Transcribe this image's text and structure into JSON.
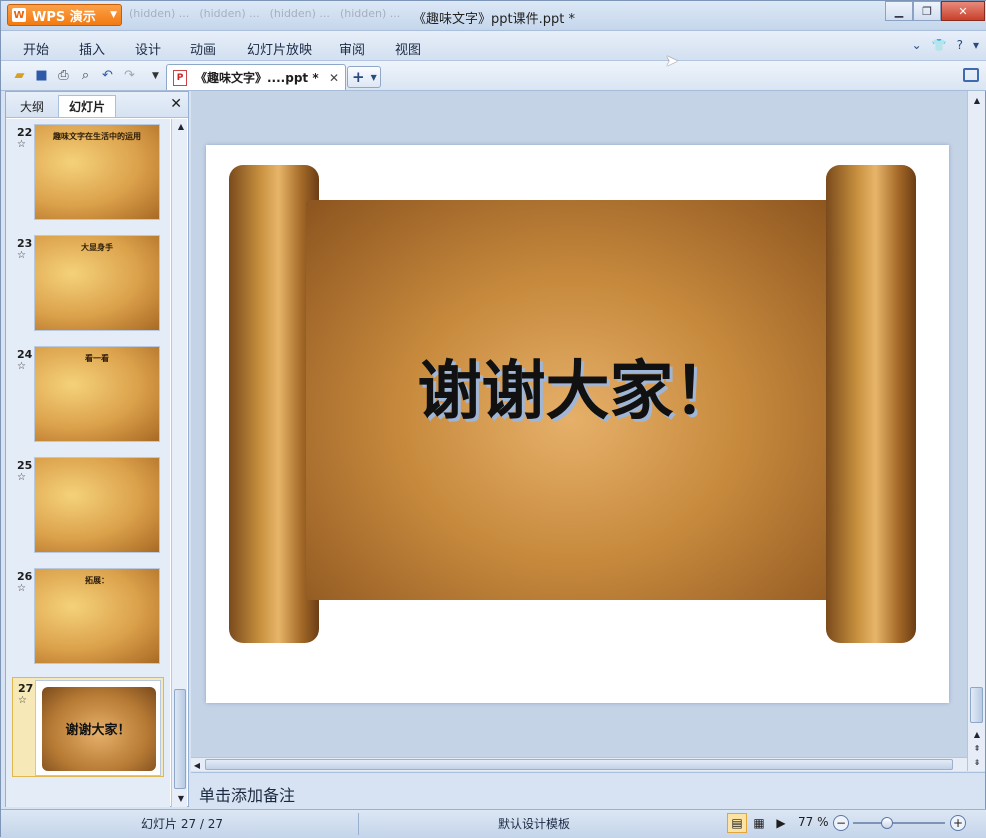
{
  "app": {
    "button_label": "WPS 演示",
    "window_title": "《趣味文字》ppt课件.ppt *",
    "ghost_tabs": [
      "(hidden) ...",
      "(hidden) ...",
      "(hidden) ...",
      "(hidden) ..."
    ]
  },
  "menu": [
    "开始",
    "插入",
    "设计",
    "动画",
    "幻灯片放映",
    "审阅",
    "视图"
  ],
  "toolbar": {
    "doc_tab_label": "《趣味文字》....ppt *",
    "new_tab_label": "+"
  },
  "left_pane": {
    "tab_outline": "大纲",
    "tab_slides": "幻灯片",
    "close_label": "✕",
    "thumbnails": [
      {
        "num": "22",
        "title": "趣味文字在生活中的运用"
      },
      {
        "num": "23",
        "title": "大显身手"
      },
      {
        "num": "24",
        "title": "看一看"
      },
      {
        "num": "25",
        "title": ""
      },
      {
        "num": "26",
        "title": "拓展："
      },
      {
        "num": "27",
        "title": "谢谢大家！"
      }
    ],
    "selected_index": 5
  },
  "slide": {
    "text": "谢谢大家！"
  },
  "notes_placeholder": "单击添加备注",
  "status": {
    "slide_counter": "幻灯片 27 / 27",
    "template": "默认设计模板",
    "zoom": "77 %"
  },
  "colors": {
    "wps_orange": "#f27a10",
    "chrome_blue": "#d7e3f2",
    "selected_thumb": "#f6e9b7"
  }
}
